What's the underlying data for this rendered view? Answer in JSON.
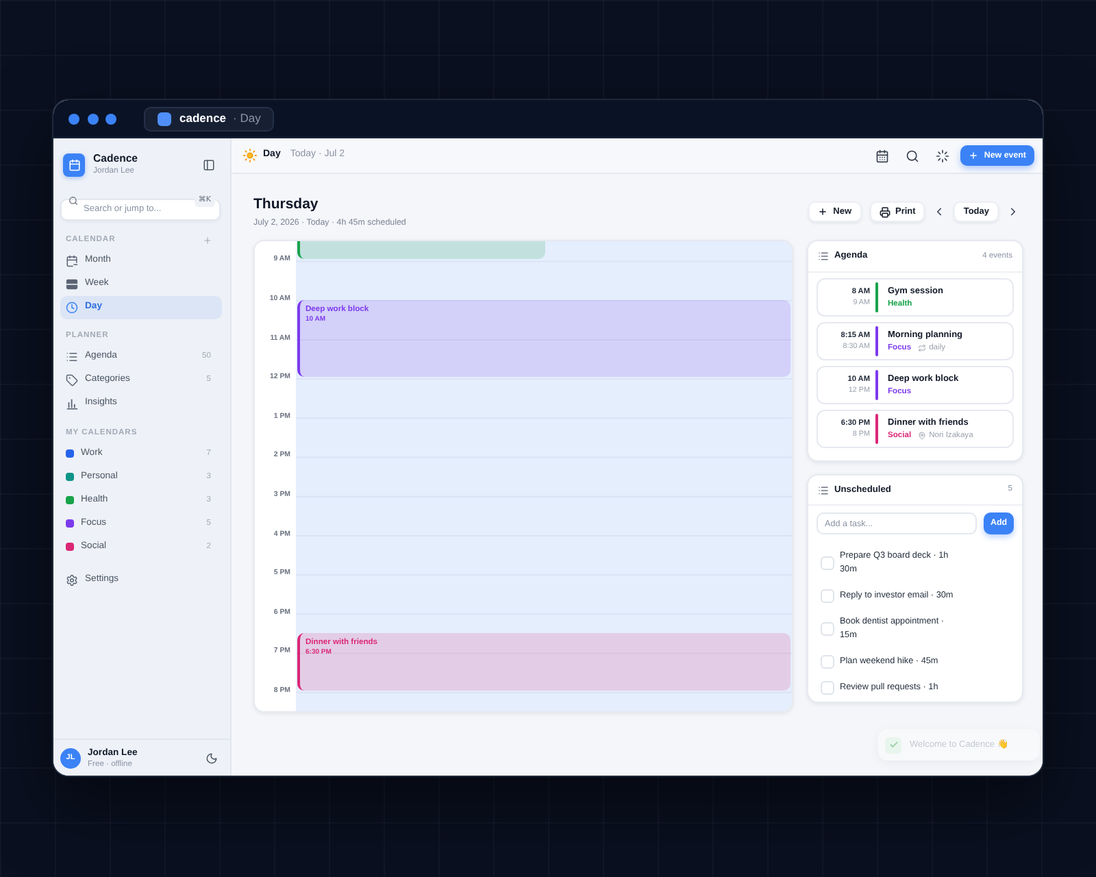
{
  "window": {
    "tab": {
      "app": "cadence",
      "view": "· Day"
    }
  },
  "sidebar": {
    "app_name": "Cadence",
    "user": "Jordan Lee",
    "search": {
      "placeholder": "Search or jump to...",
      "shortcut": "⌘K"
    },
    "sections": [
      {
        "title": "CALENDAR",
        "kind": "views",
        "items": [
          {
            "label": "Month",
            "selected": false
          },
          {
            "label": "Week",
            "selected": false
          },
          {
            "label": "Day",
            "selected": true
          }
        ]
      },
      {
        "title": "PLANNER",
        "kind": "planner",
        "items": [
          {
            "label": "Agenda",
            "count": "50"
          },
          {
            "label": "Categories",
            "count": "5"
          },
          {
            "label": "Insights"
          }
        ]
      },
      {
        "title": "MY CALENDARS",
        "kind": "calendars",
        "items": [
          {
            "label": "Work",
            "count": "7",
            "color": "#2563eb"
          },
          {
            "label": "Personal",
            "count": "3",
            "color": "#0d9488"
          },
          {
            "label": "Health",
            "count": "3",
            "color": "#16a34a"
          },
          {
            "label": "Focus",
            "count": "5",
            "color": "#7c3aed"
          },
          {
            "label": "Social",
            "count": "2",
            "color": "#db2777"
          }
        ]
      }
    ],
    "settings": "Settings",
    "account": {
      "initials": "JL",
      "name": "Jordan Lee",
      "status": "Free · offline"
    }
  },
  "topbar": {
    "view": "Day",
    "date": "Today · Jul 2",
    "new_event": "New event"
  },
  "day": {
    "title": "Thursday",
    "subtitle": "July 2, 2026 · Today · 4h 45m scheduled",
    "actions": [
      "New",
      "Print",
      "Today"
    ]
  },
  "grid": {
    "hours": [
      "9 AM",
      "10 AM",
      "11 AM",
      "12 PM",
      "1 PM",
      "2 PM",
      "3 PM",
      "4 PM",
      "5 PM",
      "6 PM",
      "7 PM",
      "8 PM"
    ],
    "events": [
      {
        "kind": "clipped",
        "color": "#16a34a"
      },
      {
        "kind": "block",
        "title": "Deep work block",
        "time": "10 AM",
        "color": "#7c3aed"
      },
      {
        "kind": "block",
        "title": "Dinner with friends",
        "time": "6:30 PM",
        "color": "#db2777"
      }
    ]
  },
  "agenda": {
    "title": "Agenda",
    "count": "4 events",
    "events": [
      {
        "start": "8 AM",
        "end": "9 AM",
        "title": "Gym session",
        "category": "Health",
        "color": "#16a34a"
      },
      {
        "start": "8:15 AM",
        "end": "8:30 AM",
        "title": "Morning planning",
        "category": "Focus",
        "color": "#7c3aed",
        "note": {
          "kind": "repeat",
          "text": "daily"
        }
      },
      {
        "start": "10 AM",
        "end": "12 PM",
        "title": "Deep work block",
        "category": "Focus",
        "color": "#7c3aed"
      },
      {
        "start": "6:30 PM",
        "end": "8 PM",
        "title": "Dinner with friends",
        "category": "Social",
        "color": "#db2777",
        "note": {
          "kind": "place",
          "text": "Nori Izakaya"
        }
      }
    ]
  },
  "unscheduled": {
    "title": "Unscheduled",
    "count": "5",
    "input": {
      "placeholder": "Add a task..."
    },
    "add_button": "Add",
    "tasks": [
      {
        "label": "Prepare Q3 board deck · 1h 30m",
        "checked": false
      },
      {
        "label": "Reply to investor email · 30m",
        "checked": false
      },
      {
        "label": "Book dentist appointment · 15m",
        "checked": false
      },
      {
        "label": "Plan weekend hike · 45m",
        "checked": false
      },
      {
        "label": "Review pull requests · 1h",
        "checked": false
      }
    ]
  },
  "toast": {
    "text": "Welcome to Cadence 👋"
  }
}
